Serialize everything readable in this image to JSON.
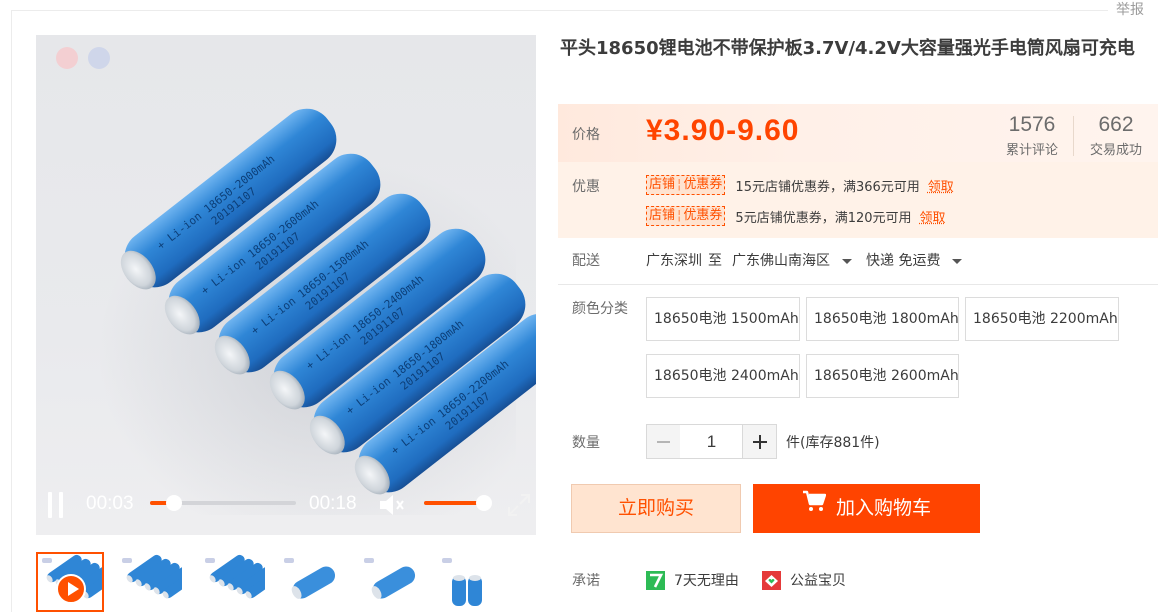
{
  "header": {
    "report_label": "举报"
  },
  "product": {
    "title": "平头18650锂电池不带保护板3.7V/4.2V大容量强光手电筒风扇可充电"
  },
  "gallery": {
    "battery_labels": [
      "+ Li-ion 18650-2000mAh",
      "+ Li-ion 18650-2600mAh",
      "+ Li-ion 18650-1500mAh",
      "+ Li-ion 18650-2400mAh",
      "+ Li-ion 18650-1800mAh",
      "+ Li-ion 18650-2200mAh"
    ],
    "battery_date": "20191107",
    "video": {
      "current_time": "00:03",
      "total_time": "00:18",
      "progress": 0.167,
      "volume": 1.0
    },
    "thumb_count": 6,
    "active_thumb": 0
  },
  "price": {
    "label": "价格",
    "value": "¥3.90-9.60",
    "reviews_count": "1576",
    "reviews_label": "累计评论",
    "sales_count": "662",
    "sales_label": "交易成功"
  },
  "coupons": {
    "label": "优惠",
    "tag_left": "店铺",
    "tag_right": "优惠券",
    "items": [
      {
        "text": "15元店铺优惠券，满366元可用",
        "link": "领取"
      },
      {
        "text": "5元店铺优惠券，满120元可用",
        "link": "领取"
      }
    ]
  },
  "shipping": {
    "label": "配送",
    "from": "广东深圳",
    "to_word": "至",
    "to": "广东佛山南海区",
    "method": "快递 免运费"
  },
  "sku": {
    "label": "颜色分类",
    "options": [
      "18650电池 1500mAh",
      "18650电池 1800mAh",
      "18650电池 2200mAh",
      "18650电池 2400mAh",
      "18650电池 2600mAh"
    ]
  },
  "quantity": {
    "label": "数量",
    "value": "1",
    "stock_text": "件(库存881件)"
  },
  "actions": {
    "buy_now": "立即购买",
    "add_to_cart": "加入购物车"
  },
  "promise": {
    "label": "承诺",
    "items": [
      {
        "text": "7天无理由",
        "icon": "seven-days-icon"
      },
      {
        "text": "公益宝贝",
        "icon": "charity-icon"
      }
    ]
  },
  "colors": {
    "accent": "#ff5000",
    "price": "#ff4400",
    "battery_blue": "#2f86d6"
  }
}
